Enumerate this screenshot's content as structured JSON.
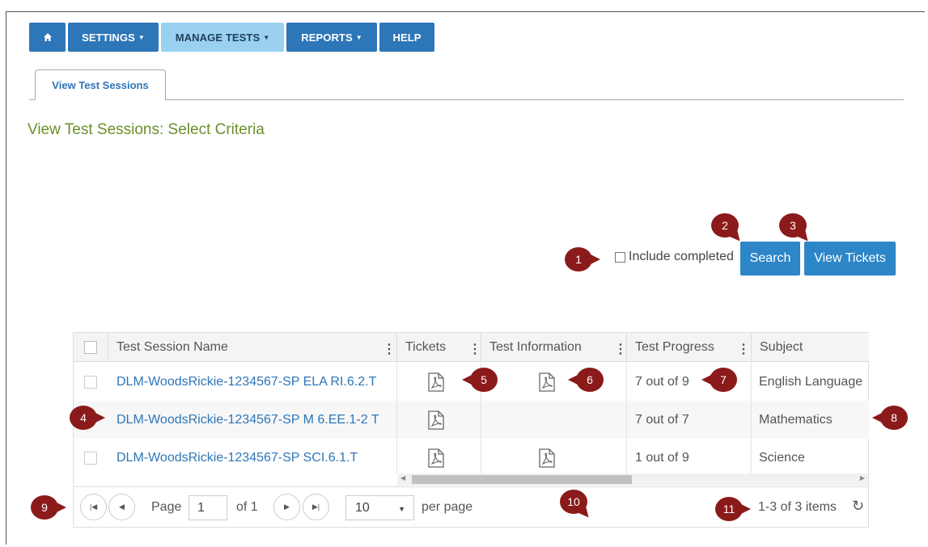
{
  "nav": {
    "home_icon": "home-icon",
    "items": [
      {
        "label": "SETTINGS",
        "has_caret": true
      },
      {
        "label": "MANAGE TESTS",
        "has_caret": true
      },
      {
        "label": "REPORTS",
        "has_caret": true
      },
      {
        "label": "HELP",
        "has_caret": false
      }
    ],
    "active": "MANAGE TESTS",
    "colors": {
      "primary": "#2d76b8",
      "active": "#9ad0f0"
    }
  },
  "tab": {
    "label": "View Test Sessions"
  },
  "page": {
    "title": "View Test Sessions: Select Criteria",
    "title_color": "#6a8f2c"
  },
  "criteria": {
    "include_completed_label": "Include completed",
    "include_completed_checked": false,
    "search_label": "Search",
    "view_tickets_label": "View Tickets"
  },
  "grid": {
    "columns": [
      "Test Session Name",
      "Tickets",
      "Test Information",
      "Test Progress",
      "Subject"
    ],
    "rows": [
      {
        "name": "DLM-WoodsRickie-1234567-SP ELA RI.6.2.T",
        "ticket": true,
        "info": true,
        "progress": "7 out of 9",
        "subject": "English Language"
      },
      {
        "name": "DLM-WoodsRickie-1234567-SP M 6.EE.1-2 T",
        "ticket": true,
        "info": false,
        "progress": "7 out of 7",
        "subject": "Mathematics"
      },
      {
        "name": "DLM-WoodsRickie-1234567-SP SCI.6.1.T",
        "ticket": true,
        "info": true,
        "progress": "1 out of 9",
        "subject": "Science"
      }
    ]
  },
  "pager": {
    "page_label": "Page",
    "page_value": "1",
    "of_label": "of 1",
    "per_page_value": "10",
    "per_page_label": "per page",
    "items_summary": "1-3 of 3 items"
  },
  "callouts": [
    "1",
    "2",
    "3",
    "4",
    "5",
    "6",
    "7",
    "8",
    "9",
    "10",
    "11"
  ],
  "callout_color": "#8b1a1a"
}
